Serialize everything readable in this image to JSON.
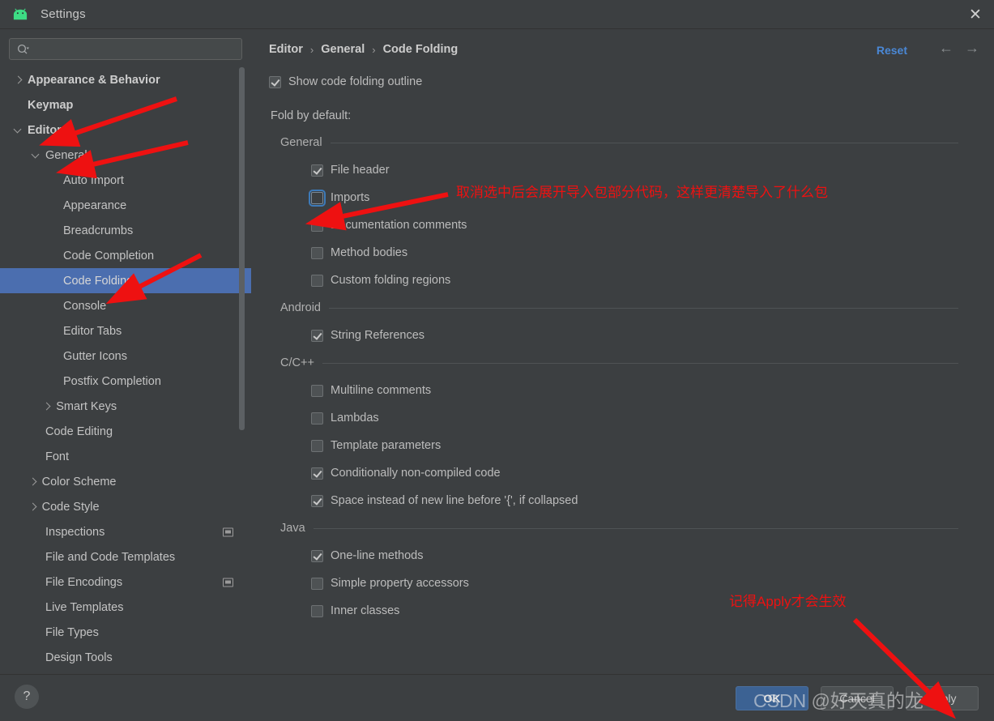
{
  "window": {
    "title": "Settings",
    "app_icon": "android-icon",
    "close_icon": "✕"
  },
  "sidebar": {
    "search": {
      "value": "",
      "placeholder": ""
    },
    "items": [
      {
        "label": "Appearance & Behavior",
        "indent": 0,
        "twisty": "collapsed",
        "bold": true,
        "selected": false,
        "badge": false
      },
      {
        "label": "Keymap",
        "indent": 0,
        "twisty": "none",
        "bold": true,
        "selected": false,
        "badge": false
      },
      {
        "label": "Editor",
        "indent": 0,
        "twisty": "expanded",
        "bold": true,
        "selected": false,
        "badge": false
      },
      {
        "label": "General",
        "indent": 1,
        "twisty": "expanded",
        "bold": false,
        "selected": false,
        "badge": false
      },
      {
        "label": "Auto Import",
        "indent": 2,
        "twisty": "none",
        "bold": false,
        "selected": false,
        "badge": false
      },
      {
        "label": "Appearance",
        "indent": 2,
        "twisty": "none",
        "bold": false,
        "selected": false,
        "badge": false
      },
      {
        "label": "Breadcrumbs",
        "indent": 2,
        "twisty": "none",
        "bold": false,
        "selected": false,
        "badge": false
      },
      {
        "label": "Code Completion",
        "indent": 2,
        "twisty": "none",
        "bold": false,
        "selected": false,
        "badge": false
      },
      {
        "label": "Code Folding",
        "indent": 2,
        "twisty": "none",
        "bold": false,
        "selected": true,
        "badge": false
      },
      {
        "label": "Console",
        "indent": 2,
        "twisty": "none",
        "bold": false,
        "selected": false,
        "badge": false
      },
      {
        "label": "Editor Tabs",
        "indent": 2,
        "twisty": "none",
        "bold": false,
        "selected": false,
        "badge": false
      },
      {
        "label": "Gutter Icons",
        "indent": 2,
        "twisty": "none",
        "bold": false,
        "selected": false,
        "badge": false
      },
      {
        "label": "Postfix Completion",
        "indent": 2,
        "twisty": "none",
        "bold": false,
        "selected": false,
        "badge": false
      },
      {
        "label": "Smart Keys",
        "indent": 1.6,
        "twisty": "collapsed",
        "bold": false,
        "selected": false,
        "badge": false
      },
      {
        "label": "Code Editing",
        "indent": 1,
        "twisty": "none",
        "bold": false,
        "selected": false,
        "badge": false
      },
      {
        "label": "Font",
        "indent": 1,
        "twisty": "none",
        "bold": false,
        "selected": false,
        "badge": false
      },
      {
        "label": "Color Scheme",
        "indent": 0.8,
        "twisty": "collapsed",
        "bold": false,
        "selected": false,
        "badge": false
      },
      {
        "label": "Code Style",
        "indent": 0.8,
        "twisty": "collapsed",
        "bold": false,
        "selected": false,
        "badge": false
      },
      {
        "label": "Inspections",
        "indent": 1,
        "twisty": "none",
        "bold": false,
        "selected": false,
        "badge": true
      },
      {
        "label": "File and Code Templates",
        "indent": 1,
        "twisty": "none",
        "bold": false,
        "selected": false,
        "badge": false
      },
      {
        "label": "File Encodings",
        "indent": 1,
        "twisty": "none",
        "bold": false,
        "selected": false,
        "badge": true
      },
      {
        "label": "Live Templates",
        "indent": 1,
        "twisty": "none",
        "bold": false,
        "selected": false,
        "badge": false
      },
      {
        "label": "File Types",
        "indent": 1,
        "twisty": "none",
        "bold": false,
        "selected": false,
        "badge": false
      },
      {
        "label": "Design Tools",
        "indent": 1,
        "twisty": "none",
        "bold": false,
        "selected": false,
        "badge": false
      }
    ]
  },
  "main": {
    "breadcrumb": [
      "Editor",
      "General",
      "Code Folding"
    ],
    "breadcrumb_separator": "›",
    "reset_label": "Reset",
    "nav_back_icon": "←",
    "nav_forward_icon": "→",
    "show_outline": {
      "label": "Show code folding outline",
      "checked": true
    },
    "fold_by_default_label": "Fold by default:",
    "groups": [
      {
        "title": "General",
        "items": [
          {
            "label": "File header",
            "checked": true,
            "focused": false
          },
          {
            "label": "Imports",
            "checked": false,
            "focused": true
          },
          {
            "label": "Documentation comments",
            "checked": false,
            "focused": false
          },
          {
            "label": "Method bodies",
            "checked": false,
            "focused": false
          },
          {
            "label": "Custom folding regions",
            "checked": false,
            "focused": false
          }
        ]
      },
      {
        "title": "Android",
        "items": [
          {
            "label": "String References",
            "checked": true,
            "focused": false
          }
        ]
      },
      {
        "title": "C/C++",
        "items": [
          {
            "label": "Multiline comments",
            "checked": false,
            "focused": false
          },
          {
            "label": "Lambdas",
            "checked": false,
            "focused": false
          },
          {
            "label": "Template parameters",
            "checked": false,
            "focused": false
          },
          {
            "label": "Conditionally non-compiled code",
            "checked": true,
            "focused": false
          },
          {
            "label": "Space instead of new line before '{', if collapsed",
            "checked": true,
            "focused": false
          }
        ]
      },
      {
        "title": "Java",
        "items": [
          {
            "label": "One-line methods",
            "checked": true,
            "focused": false
          },
          {
            "label": "Simple property accessors",
            "checked": false,
            "focused": false
          },
          {
            "label": "Inner classes",
            "checked": false,
            "focused": false
          }
        ]
      }
    ]
  },
  "bottom": {
    "help_label": "?",
    "ok_label": "OK",
    "cancel_label": "Cancel",
    "apply_label": "Apply"
  },
  "annotations": {
    "imports_note": "取消选中后会展开导入包部分代码，这样更清楚导入了什么包",
    "apply_note": "记得Apply才会生效"
  },
  "watermark": "CSDN @好天真的龙",
  "colors": {
    "background": "#3c3f41",
    "selection": "#4b6eaf",
    "accent_link": "#4a88d6",
    "primary_button": "#3c6293",
    "annotation_red": "#ee1111",
    "android_green": "#3ddc84"
  }
}
